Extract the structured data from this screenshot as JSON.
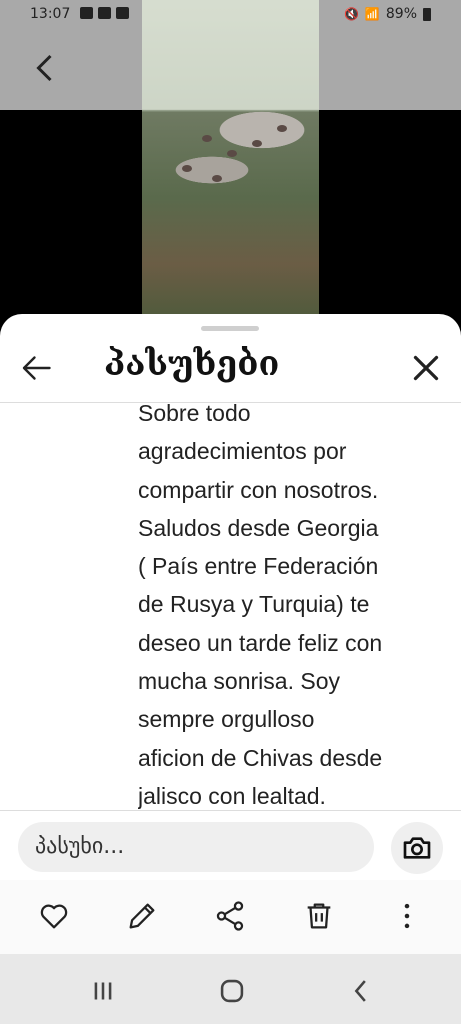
{
  "status_bar": {
    "time": "13:07",
    "battery": "89%"
  },
  "sheet": {
    "title": "პასუხები",
    "reply_text": "Sobre todo\nagradecimientos por\ncompartir con nosotros.\nSaludos desde Georgia\n( País entre Federación\nde Rusya y Turquia)   te\ndeseo un tarde feliz con\nmucha sonrisa. Soy\nsempre orgulloso\naficion de Chivas desde\njalisco con lealtad.",
    "reply_placeholder": "პასუხი..."
  },
  "icons": {
    "back": "back-arrow-icon",
    "close": "close-icon",
    "camera": "camera-icon",
    "actions": [
      "heart-icon",
      "pencil-icon",
      "share-icon",
      "trash-icon",
      "more-vertical-icon"
    ],
    "nav": [
      "recent-apps-icon",
      "home-icon",
      "back-icon"
    ]
  },
  "colors": {
    "sheet_bg": "#ffffff",
    "input_bg": "#efefef",
    "nav_bg": "#e8e8e8"
  }
}
